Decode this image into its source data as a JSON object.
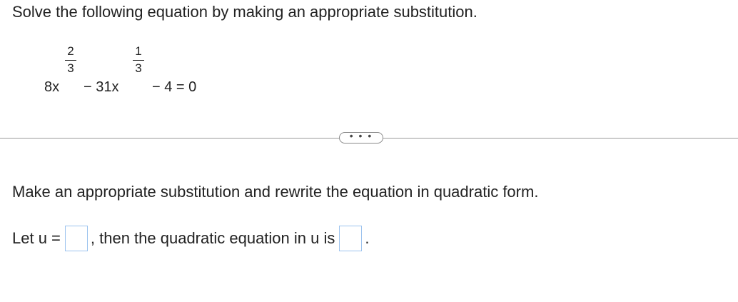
{
  "question": {
    "prompt": "Solve the following equation by making an appropriate substitution.",
    "equation": {
      "term1_coeff": "8x",
      "term1_exp_num": "2",
      "term1_exp_den": "3",
      "term2": "− 31x",
      "term2_exp_num": "1",
      "term2_exp_den": "3",
      "term3": "− 4 = 0"
    }
  },
  "more_button": {
    "label": "• • •"
  },
  "part": {
    "instruction": "Make an appropriate substitution and rewrite the equation in quadratic form.",
    "let_label": "Let u =",
    "middle_text": ", then the quadratic equation in u is",
    "end_text": "."
  },
  "colors": {
    "text": "#222222",
    "divider": "#9a9a9a",
    "answer_box_border": "#9cc3ee"
  }
}
